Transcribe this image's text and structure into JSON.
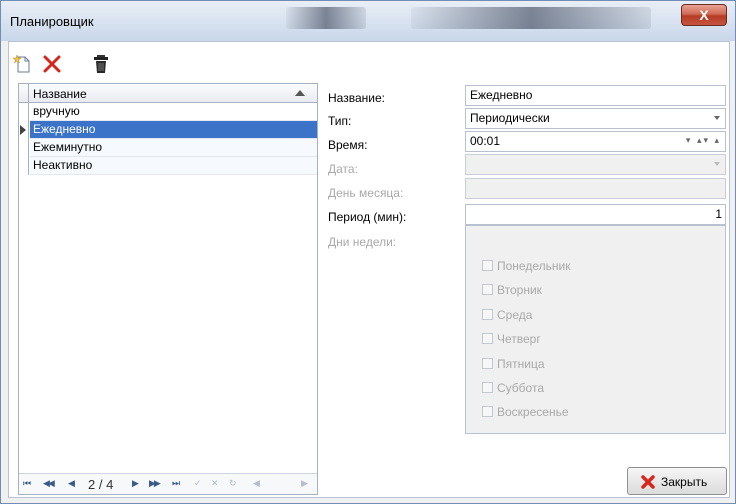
{
  "window": {
    "title": "Планировщик",
    "close_glyph": "X"
  },
  "toolbar": {
    "buttons": [
      {
        "icon": "new-document-icon"
      },
      {
        "icon": "delete-x-icon",
        "color": "#d9261c"
      },
      {
        "icon": "trash-icon"
      }
    ]
  },
  "grid": {
    "column_header": "Название",
    "rows": [
      "вручную",
      "Ежедневно",
      "Ежеминутно",
      "Неактивно"
    ],
    "selected_index": 1,
    "selection_color": "#3a73c8",
    "navigator": {
      "first": "⏮",
      "prev_page": "◀◀",
      "prev": "◀",
      "position": "2 / 4",
      "next": "▶",
      "next_page": "▶▶",
      "last": "⏭",
      "apply": "✓",
      "cancel": "✕",
      "refresh": "↻",
      "scroll_left": "◀",
      "scroll_right": "▶"
    }
  },
  "form": {
    "name_label": "Название:",
    "name_value": "Ежедневно",
    "type_label": "Тип:",
    "type_value": "Периодически",
    "time_label": "Время:",
    "time_value": "00:01",
    "date_label": "Дата:",
    "date_value": "",
    "day_of_month_label": "День месяца:",
    "day_of_month_value": "",
    "period_label": "Период (мин):",
    "period_value": "1",
    "weekdays_label": "Дни недели:",
    "weekdays": [
      "Понедельник",
      "Вторник",
      "Среда",
      "Четверг",
      "Пятница",
      "Суббота",
      "Воскресенье"
    ]
  },
  "actions": {
    "close_label": "Закрыть",
    "close_icon": "red-x-icon"
  }
}
